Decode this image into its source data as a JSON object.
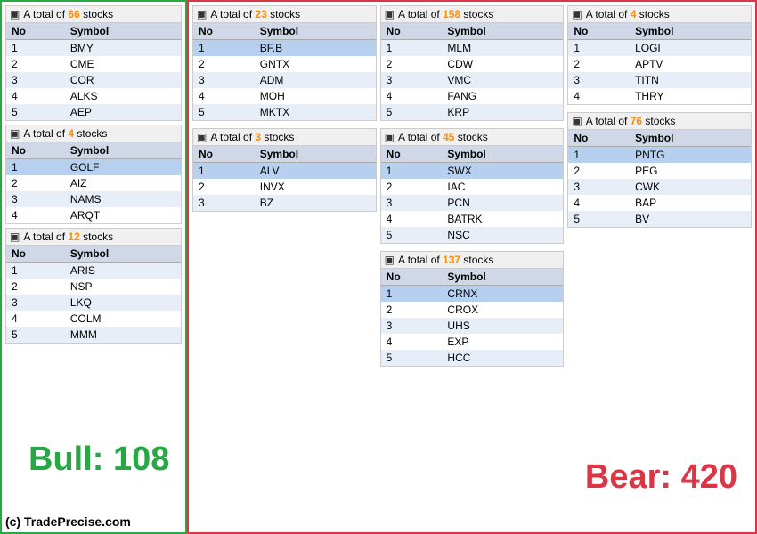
{
  "leftPanel": {
    "tables": [
      {
        "id": "table-66",
        "header": "A total of 66 stocks",
        "count": "66",
        "columns": [
          "No",
          "Symbol"
        ],
        "rows": [
          {
            "no": "1",
            "symbol": "BMY",
            "highlight": false
          },
          {
            "no": "2",
            "symbol": "CME",
            "highlight": false
          },
          {
            "no": "3",
            "symbol": "COR",
            "highlight": false
          },
          {
            "no": "4",
            "symbol": "ALKS",
            "highlight": false
          },
          {
            "no": "5",
            "symbol": "AEP",
            "highlight": false
          }
        ]
      },
      {
        "id": "table-4a",
        "header": "A total of 4 stocks",
        "count": "4",
        "columns": [
          "No",
          "Symbol"
        ],
        "rows": [
          {
            "no": "1",
            "symbol": "GOLF",
            "highlight": true
          },
          {
            "no": "2",
            "symbol": "AIZ",
            "highlight": false
          },
          {
            "no": "3",
            "symbol": "NAMS",
            "highlight": false
          },
          {
            "no": "4",
            "symbol": "ARQT",
            "highlight": false
          }
        ]
      },
      {
        "id": "table-12",
        "header": "A total of 12 stocks",
        "count": "12",
        "columns": [
          "No",
          "Symbol"
        ],
        "rows": [
          {
            "no": "1",
            "symbol": "ARIS",
            "highlight": false
          },
          {
            "no": "2",
            "symbol": "NSP",
            "highlight": false
          },
          {
            "no": "3",
            "symbol": "LKQ",
            "highlight": false
          },
          {
            "no": "4",
            "symbol": "COLM",
            "highlight": false
          },
          {
            "no": "5",
            "symbol": "MMM",
            "highlight": false
          }
        ]
      }
    ],
    "bullLabel": "Bull: 108"
  },
  "rightPanel": {
    "cols": [
      {
        "tables": [
          {
            "id": "table-23",
            "header": "A total of 23 stocks",
            "count": "23",
            "columns": [
              "No",
              "Symbol"
            ],
            "rows": [
              {
                "no": "1",
                "symbol": "BF.B",
                "highlight": true
              },
              {
                "no": "2",
                "symbol": "GNTX",
                "highlight": false
              },
              {
                "no": "3",
                "symbol": "ADM",
                "highlight": false
              },
              {
                "no": "4",
                "symbol": "MOH",
                "highlight": false
              },
              {
                "no": "5",
                "symbol": "MKTX",
                "highlight": false
              }
            ]
          },
          {
            "id": "table-3",
            "header": "A total of 3 stocks",
            "count": "3",
            "columns": [
              "No",
              "Symbol"
            ],
            "rows": [
              {
                "no": "1",
                "symbol": "ALV",
                "highlight": true
              },
              {
                "no": "2",
                "symbol": "INVX",
                "highlight": false
              },
              {
                "no": "3",
                "symbol": "BZ",
                "highlight": false
              }
            ]
          }
        ]
      },
      {
        "tables": [
          {
            "id": "table-158",
            "header": "A total of 158 stocks",
            "count": "158",
            "columns": [
              "No",
              "Symbol"
            ],
            "rows": [
              {
                "no": "1",
                "symbol": "MLM",
                "highlight": false
              },
              {
                "no": "2",
                "symbol": "CDW",
                "highlight": false
              },
              {
                "no": "3",
                "symbol": "VMC",
                "highlight": false
              },
              {
                "no": "4",
                "symbol": "FANG",
                "highlight": false
              },
              {
                "no": "5",
                "symbol": "KRP",
                "highlight": false
              }
            ]
          },
          {
            "id": "table-45",
            "header": "A total of 45 stocks",
            "count": "45",
            "columns": [
              "No",
              "Symbol"
            ],
            "rows": [
              {
                "no": "1",
                "symbol": "SWX",
                "highlight": true
              },
              {
                "no": "2",
                "symbol": "IAC",
                "highlight": false
              },
              {
                "no": "3",
                "symbol": "PCN",
                "highlight": false
              },
              {
                "no": "4",
                "symbol": "BATRK",
                "highlight": false
              },
              {
                "no": "5",
                "symbol": "NSC",
                "highlight": false
              }
            ]
          },
          {
            "id": "table-137",
            "header": "A total of 137 stocks",
            "count": "137",
            "columns": [
              "No",
              "Symbol"
            ],
            "rows": [
              {
                "no": "1",
                "symbol": "CRNX",
                "highlight": true
              },
              {
                "no": "2",
                "symbol": "CROX",
                "highlight": false
              },
              {
                "no": "3",
                "symbol": "UHS",
                "highlight": false
              },
              {
                "no": "4",
                "symbol": "EXP",
                "highlight": false
              },
              {
                "no": "5",
                "symbol": "HCC",
                "highlight": false
              }
            ]
          }
        ]
      },
      {
        "tables": [
          {
            "id": "table-4b",
            "header": "A total of 4 stocks",
            "count": "4",
            "columns": [
              "No",
              "Symbol"
            ],
            "rows": [
              {
                "no": "1",
                "symbol": "LOGI",
                "highlight": false
              },
              {
                "no": "2",
                "symbol": "APTV",
                "highlight": false
              },
              {
                "no": "3",
                "symbol": "TITN",
                "highlight": false
              },
              {
                "no": "4",
                "symbol": "THRY",
                "highlight": false
              }
            ]
          },
          {
            "id": "table-76",
            "header": "A total of 76 stocks",
            "count": "76",
            "columns": [
              "No",
              "Symbol"
            ],
            "rows": [
              {
                "no": "1",
                "symbol": "PNTG",
                "highlight": true
              },
              {
                "no": "2",
                "symbol": "PEG",
                "highlight": false
              },
              {
                "no": "3",
                "symbol": "CWK",
                "highlight": false
              },
              {
                "no": "4",
                "symbol": "BAP",
                "highlight": false
              },
              {
                "no": "5",
                "symbol": "BV",
                "highlight": false
              }
            ]
          }
        ]
      }
    ],
    "bearLabel": "Bear: 420"
  },
  "copyright": "(c) TradePrecise.com"
}
